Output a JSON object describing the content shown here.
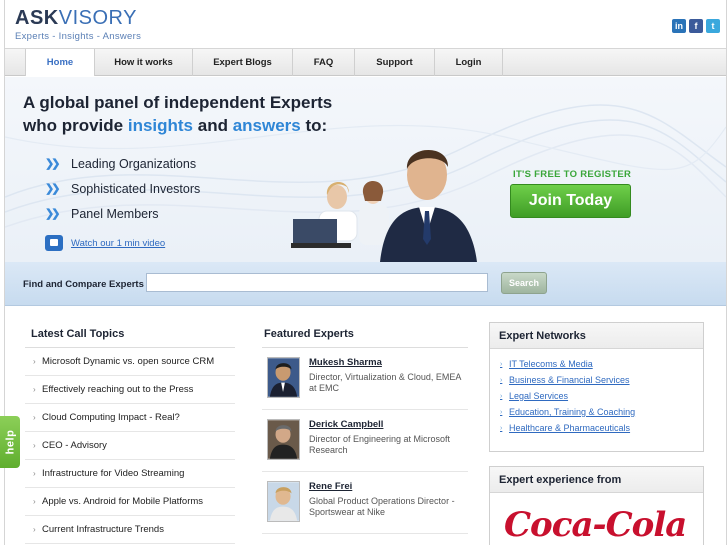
{
  "header": {
    "logo_main_1": "ASK",
    "logo_main_2": "VISORY",
    "tagline": "Experts - Insights - Answers",
    "social": [
      {
        "icon": "linkedin-icon",
        "glyph": "in"
      },
      {
        "icon": "facebook-icon",
        "glyph": "f"
      },
      {
        "icon": "twitter-icon",
        "glyph": "t"
      }
    ]
  },
  "nav": {
    "items": [
      "Home",
      "How it works",
      "Expert Blogs",
      "FAQ",
      "Support",
      "Login"
    ],
    "active": "Home"
  },
  "hero": {
    "line1": "A global panel of independent Experts",
    "line2_a": "who provide ",
    "line2_b": "insights",
    "line2_c": " and ",
    "line2_d": "answers",
    "line2_e": " to:",
    "bullets": [
      "Leading Organizations",
      "Sophisticated Investors",
      "Panel Members"
    ],
    "video_link": "Watch our 1 min video",
    "register_text": "IT'S FREE TO REGISTER",
    "join_button": "Join Today"
  },
  "search": {
    "label": "Find and Compare Experts",
    "value": "",
    "button": "Search"
  },
  "topics": {
    "heading": "Latest Call Topics",
    "items": [
      "Microsoft Dynamic vs. open source CRM",
      "Effectively reaching out to the Press",
      "Cloud Computing Impact - Real?",
      "CEO - Advisory",
      "Infrastructure for Video Streaming",
      "Apple vs. Android for Mobile Platforms",
      "Current Infrastructure Trends"
    ]
  },
  "experts": {
    "heading": "Featured Experts",
    "items": [
      {
        "name": "Mukesh Sharma",
        "desc": "Director, Virtualization & Cloud, EMEA at EMC"
      },
      {
        "name": "Derick Campbell",
        "desc": "Director of Engineering at Microsoft Research"
      },
      {
        "name": "Rene Frei",
        "desc": "Global Product Operations Director - Sportswear at Nike"
      }
    ]
  },
  "networks": {
    "heading": "Expert Networks",
    "items": [
      "IT Telecoms & Media",
      "Business & Financial Services",
      "Legal Services",
      "Education, Training & Coaching",
      "Healthcare & Pharmaceuticals"
    ]
  },
  "experience": {
    "heading": "Expert experience from",
    "brand": "Coca-Cola"
  },
  "help_tab": "help",
  "colors": {
    "accent_blue": "#2f86d6",
    "join_green": "#4fb02f",
    "link_blue": "#2f6ac0"
  }
}
